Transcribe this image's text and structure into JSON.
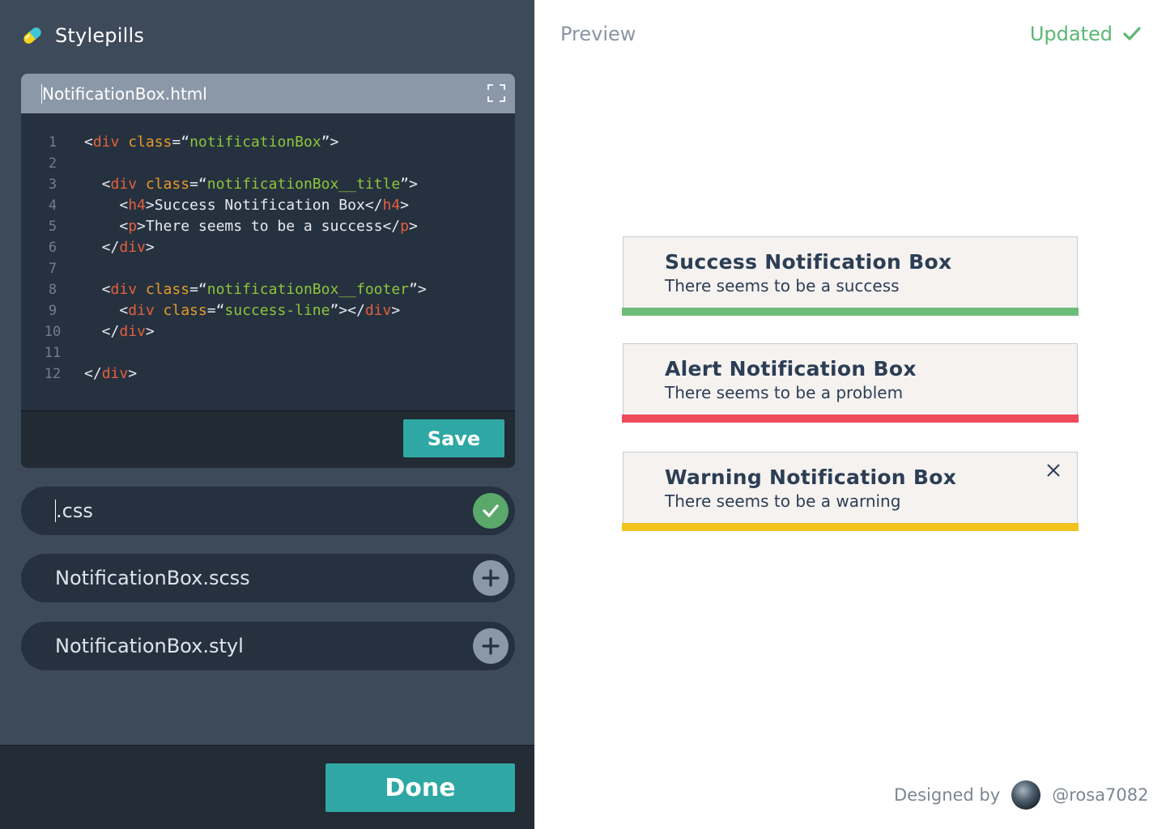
{
  "app": {
    "name": "Stylepills",
    "icon": "pill-icon"
  },
  "editor": {
    "filename": "NotificationBox.html",
    "expand_icon": "expand-icon",
    "save_label": "Save",
    "lines": [
      {
        "n": "1",
        "tokens": [
          [
            "p",
            "<"
          ],
          [
            "tag",
            "div"
          ],
          [
            "p",
            " "
          ],
          [
            "attr",
            "class"
          ],
          [
            "p",
            "=“"
          ],
          [
            "str",
            "notificationBox"
          ],
          [
            "p",
            "”>"
          ]
        ]
      },
      {
        "n": "2",
        "tokens": []
      },
      {
        "n": "3",
        "tokens": [
          [
            "p",
            "  <"
          ],
          [
            "tag",
            "div"
          ],
          [
            "p",
            " "
          ],
          [
            "attr",
            "class"
          ],
          [
            "p",
            "=“"
          ],
          [
            "str",
            "notificationBox__title"
          ],
          [
            "p",
            "”>"
          ]
        ]
      },
      {
        "n": "4",
        "tokens": [
          [
            "p",
            "    <"
          ],
          [
            "tag",
            "h4"
          ],
          [
            "p",
            ">Success Notification Box</"
          ],
          [
            "tag",
            "h4"
          ],
          [
            "p",
            ">"
          ]
        ]
      },
      {
        "n": "5",
        "tokens": [
          [
            "p",
            "    <"
          ],
          [
            "tag",
            "p"
          ],
          [
            "p",
            ">There seems to be a success</"
          ],
          [
            "tag",
            "p"
          ],
          [
            "p",
            ">"
          ]
        ]
      },
      {
        "n": "6",
        "tokens": [
          [
            "p",
            "  </"
          ],
          [
            "tag",
            "div"
          ],
          [
            "p",
            ">"
          ]
        ]
      },
      {
        "n": "7",
        "tokens": []
      },
      {
        "n": "8",
        "tokens": [
          [
            "p",
            "  <"
          ],
          [
            "tag",
            "div"
          ],
          [
            "p",
            " "
          ],
          [
            "attr",
            "class"
          ],
          [
            "p",
            "=“"
          ],
          [
            "str",
            "notificationBox__footer"
          ],
          [
            "p",
            "”>"
          ]
        ]
      },
      {
        "n": "9",
        "tokens": [
          [
            "p",
            "    <"
          ],
          [
            "tag",
            "div"
          ],
          [
            "p",
            " "
          ],
          [
            "attr",
            "class"
          ],
          [
            "p",
            "=“"
          ],
          [
            "str",
            "success-line"
          ],
          [
            "p",
            "”></"
          ],
          [
            "tag",
            "div"
          ],
          [
            "p",
            ">"
          ]
        ]
      },
      {
        "n": "10",
        "tokens": [
          [
            "p",
            "  </"
          ],
          [
            "tag",
            "div"
          ],
          [
            "p",
            ">"
          ]
        ]
      },
      {
        "n": "11",
        "tokens": []
      },
      {
        "n": "12",
        "tokens": [
          [
            "p",
            "</"
          ],
          [
            "tag",
            "div"
          ],
          [
            "p",
            ">"
          ]
        ]
      }
    ]
  },
  "files": [
    {
      "label": ".css",
      "status": "ok",
      "icon": "check-icon"
    },
    {
      "label": "NotificationBox.scss",
      "status": "add",
      "icon": "plus-icon"
    },
    {
      "label": "NotificationBox.styl",
      "status": "add",
      "icon": "plus-icon"
    }
  ],
  "done_label": "Done",
  "preview": {
    "title": "Preview",
    "status": "Updated",
    "status_icon": "check-icon",
    "boxes": [
      {
        "title": "Success Notification Box",
        "text": "There seems to be a success",
        "color": "#6cbd7a",
        "closable": false
      },
      {
        "title": "Alert Notification Box",
        "text": "There seems to be a problem",
        "color": "#ee4a5c",
        "closable": false
      },
      {
        "title": "Warning Notification Box",
        "text": "There seems to be a warning",
        "color": "#f2c320",
        "closable": true
      }
    ]
  },
  "credits": {
    "label": "Designed by",
    "handle": "@rosa7082"
  },
  "colors": {
    "sidebar": "#3d4a5a",
    "editor_bg": "#263140",
    "accent": "#2fa8a5",
    "success": "#5cb774"
  }
}
